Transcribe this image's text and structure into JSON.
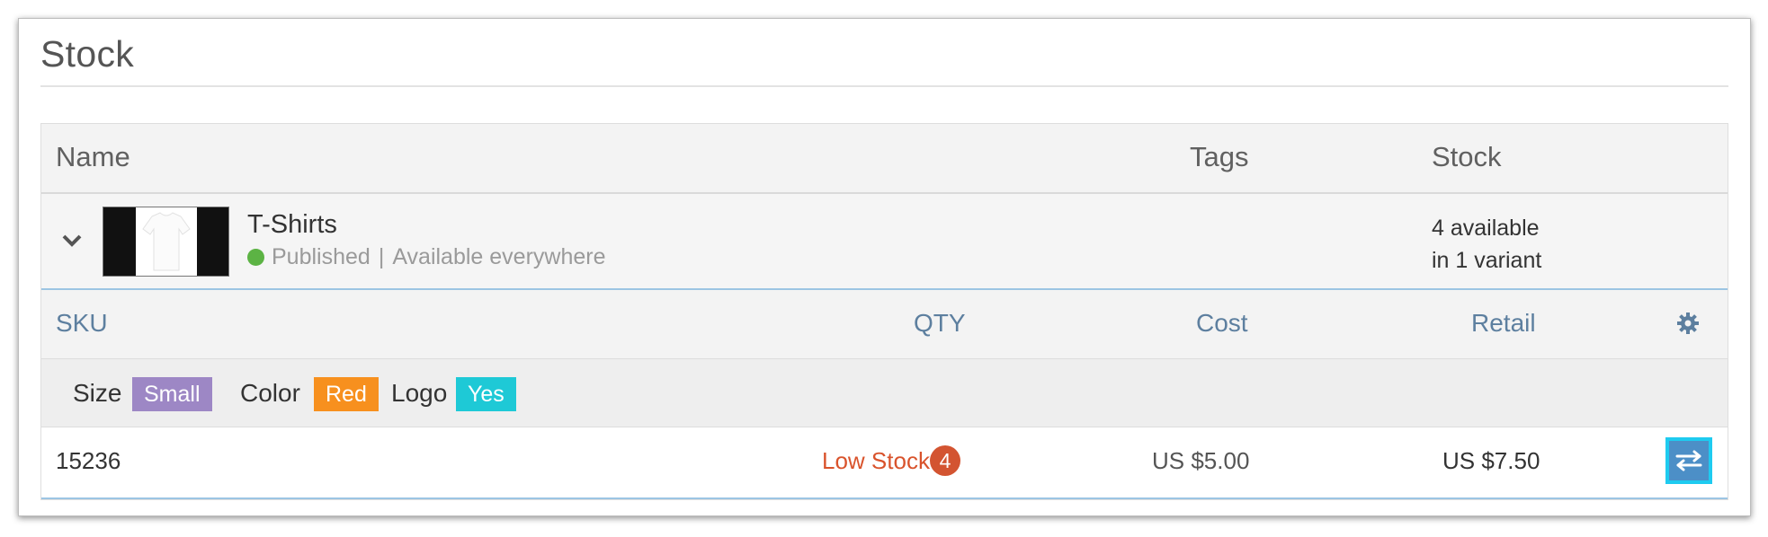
{
  "page": {
    "title": "Stock"
  },
  "table_header": {
    "name": "Name",
    "tags": "Tags",
    "stock": "Stock"
  },
  "product": {
    "name": "T-Shirts",
    "status": "Published",
    "separator": "|",
    "availability": "Available everywhere",
    "stock_line1": "4 available",
    "stock_line2": "in 1 variant",
    "status_color": "#5cb344",
    "expand_icon": "chevron-down-icon",
    "thumbnail": "t-shirt"
  },
  "variant_header": {
    "sku": "SKU",
    "qty": "QTY",
    "cost": "Cost",
    "retail": "Retail",
    "settings_icon": "gear-icon"
  },
  "variant_options": [
    {
      "label": "Size",
      "value": "Small",
      "color": "#9d87c5"
    },
    {
      "label": "Color",
      "value": "Red",
      "color": "#f7901e"
    },
    {
      "label": "Logo",
      "value": "Yes",
      "color": "#1ec9d6"
    }
  ],
  "variant_row": {
    "sku": "15236",
    "qty_status": "Low Stock",
    "qty": "4",
    "cost": "US $5.00",
    "retail": "US $7.50",
    "action_icon": "swap-arrows-icon"
  }
}
